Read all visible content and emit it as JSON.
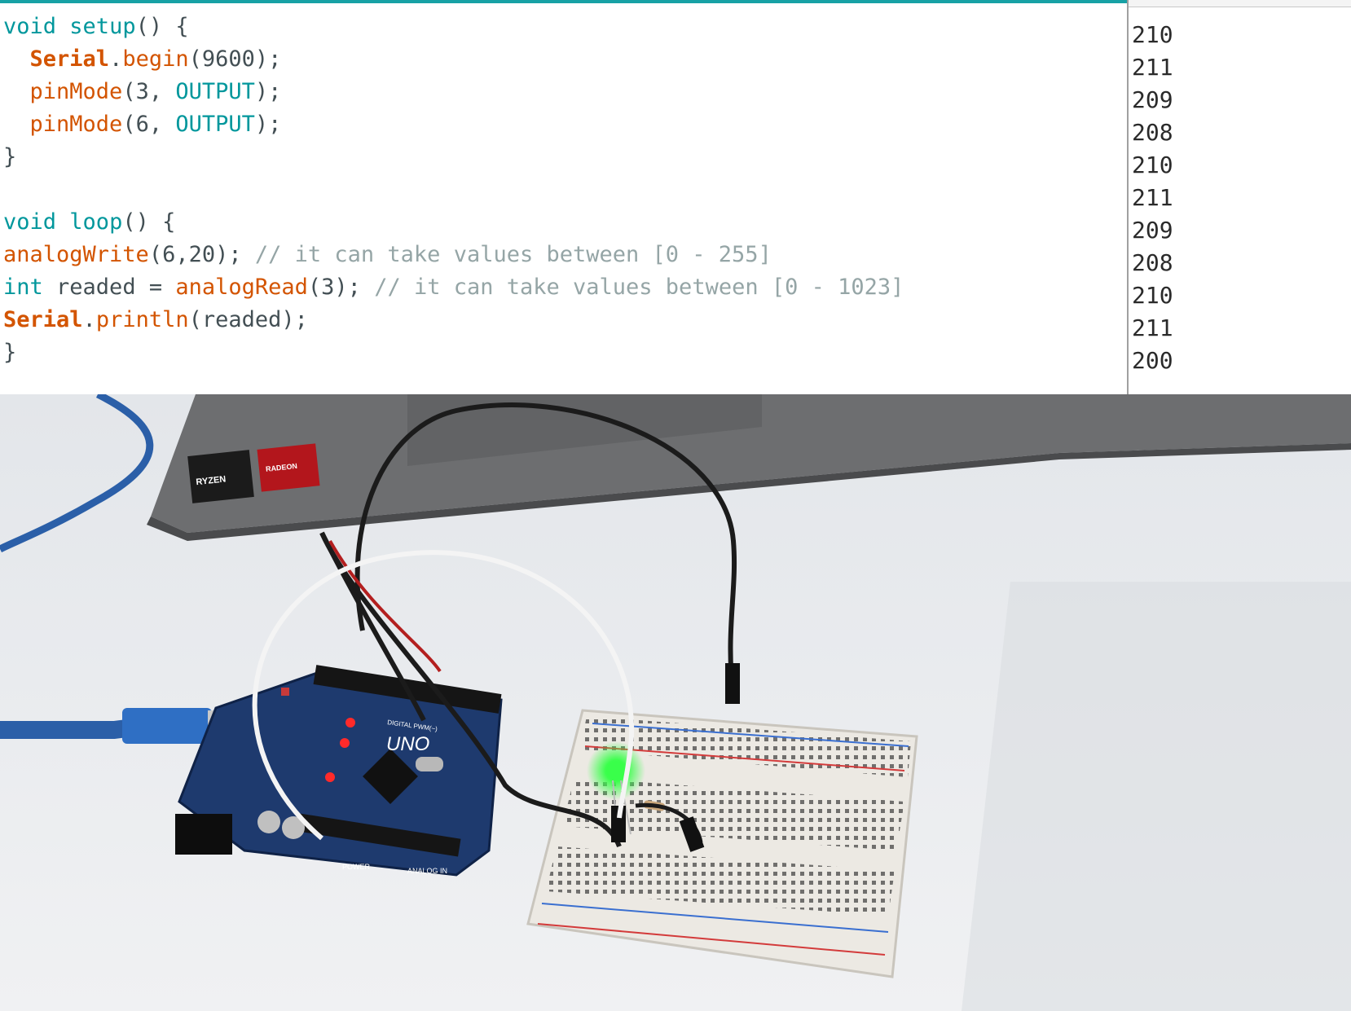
{
  "editor": {
    "lines": [
      {
        "parts": [
          {
            "t": "void",
            "c": "kw"
          },
          {
            "t": " ",
            "c": "plain"
          },
          {
            "t": "setup",
            "c": "kw"
          },
          {
            "t": "() {",
            "c": "plain"
          }
        ]
      },
      {
        "parts": [
          {
            "t": "  ",
            "c": "plain"
          },
          {
            "t": "Serial",
            "c": "obj"
          },
          {
            "t": ".",
            "c": "plain"
          },
          {
            "t": "begin",
            "c": "fn"
          },
          {
            "t": "(9600);",
            "c": "plain"
          }
        ]
      },
      {
        "parts": [
          {
            "t": "  ",
            "c": "plain"
          },
          {
            "t": "pinMode",
            "c": "fn"
          },
          {
            "t": "(3, ",
            "c": "plain"
          },
          {
            "t": "OUTPUT",
            "c": "const"
          },
          {
            "t": ");",
            "c": "plain"
          }
        ]
      },
      {
        "parts": [
          {
            "t": "  ",
            "c": "plain"
          },
          {
            "t": "pinMode",
            "c": "fn"
          },
          {
            "t": "(6, ",
            "c": "plain"
          },
          {
            "t": "OUTPUT",
            "c": "const"
          },
          {
            "t": ");",
            "c": "plain"
          }
        ]
      },
      {
        "parts": [
          {
            "t": "}",
            "c": "plain"
          }
        ]
      },
      {
        "parts": []
      },
      {
        "parts": [
          {
            "t": "void",
            "c": "kw"
          },
          {
            "t": " ",
            "c": "plain"
          },
          {
            "t": "loop",
            "c": "kw"
          },
          {
            "t": "() {",
            "c": "plain"
          }
        ]
      },
      {
        "parts": [
          {
            "t": "analogWrite",
            "c": "fn"
          },
          {
            "t": "(6,20); ",
            "c": "plain"
          },
          {
            "t": "// it can take values between [0 - 255]",
            "c": "cm"
          }
        ]
      },
      {
        "parts": [
          {
            "t": "int",
            "c": "kw"
          },
          {
            "t": " readed = ",
            "c": "plain"
          },
          {
            "t": "analogRead",
            "c": "fn"
          },
          {
            "t": "(3); ",
            "c": "plain"
          },
          {
            "t": "// it can take values between [0 - 1023]",
            "c": "cm"
          }
        ]
      },
      {
        "parts": [
          {
            "t": "Serial",
            "c": "obj"
          },
          {
            "t": ".",
            "c": "plain"
          },
          {
            "t": "println",
            "c": "fn"
          },
          {
            "t": "(readed);",
            "c": "plain"
          }
        ]
      },
      {
        "parts": [
          {
            "t": "}",
            "c": "plain"
          }
        ]
      }
    ]
  },
  "serial_monitor": {
    "values": [
      "210",
      "211",
      "209",
      "208",
      "210",
      "211",
      "209",
      "208",
      "210",
      "211",
      "200"
    ]
  },
  "photo": {
    "laptop_stickers": [
      "RYZEN",
      "RADEON"
    ],
    "board_label": "UNO",
    "board_header_labels": [
      "DIGITAL PWM(~)",
      "POWER",
      "ANALOG IN"
    ],
    "led_color": "#39ff4a"
  }
}
